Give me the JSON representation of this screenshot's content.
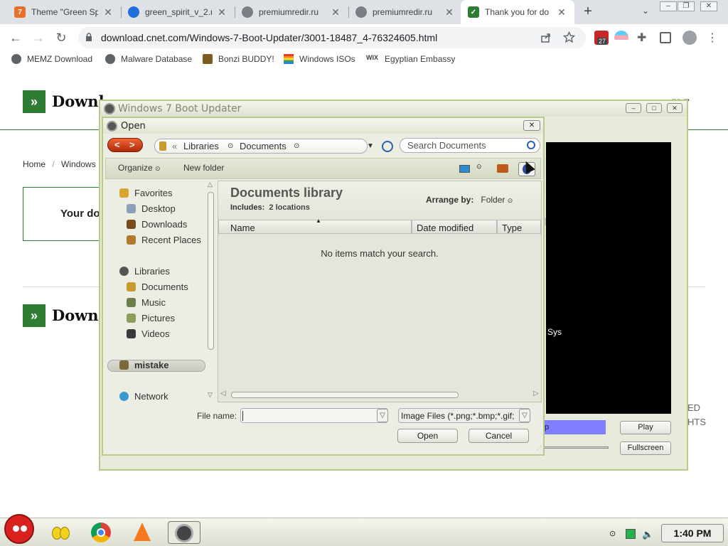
{
  "browser": {
    "tabs": [
      {
        "title": "Theme \"Green Sp",
        "favicon": "seven-favicon",
        "active": false
      },
      {
        "title": "green_spirit_v_2.r",
        "favicon": "edge-favicon",
        "active": false
      },
      {
        "title": "premiumredir.ru",
        "favicon": "globe-favicon",
        "active": false
      },
      {
        "title": "premiumredir.ru",
        "favicon": "globe-favicon",
        "active": false
      },
      {
        "title": "Thank you for do",
        "favicon": "cnet-favicon",
        "active": true
      }
    ],
    "new_tab_label": "+",
    "url": "download.cnet.com/Windows-7-Boot-Updater/3001-18487_4-76324605.html",
    "extension_badge": "27",
    "bookmarks": [
      "MEMZ Download",
      "Malware Database",
      "Bonzi BUDDY!",
      "Windows ISOs",
      "Egyptian Embassy"
    ]
  },
  "page": {
    "logo_text": "Downl",
    "logo_text_2": "Downl",
    "more_label": "re",
    "breadcrumb": [
      "Home",
      "Windows"
    ],
    "breadcrumb_sep": "/",
    "your_download_text": "Your do",
    "right_snippets": [
      "ED",
      "HTS"
    ]
  },
  "boot_updater": {
    "title": "Windows 7 Boot Updater",
    "ghost_text": "tion",
    "preview_label": "d Sys",
    "purple_label": "p",
    "play_label": "Play",
    "fullscreen_label": "Fullscreen"
  },
  "open_dialog": {
    "title": "Open",
    "close_label": "✕",
    "breadcrumb_prefix": "«",
    "breadcrumb": [
      "Libraries",
      "Documents"
    ],
    "search_placeholder": "Search Documents",
    "organize_label": "Organize",
    "new_folder_label": "New folder",
    "nav": {
      "favorites_label": "Favorites",
      "favorites": [
        "Desktop",
        "Downloads",
        "Recent Places"
      ],
      "libraries_label": "Libraries",
      "libraries": [
        "Documents",
        "Music",
        "Pictures",
        "Videos"
      ],
      "homegroup_label": "mistake",
      "network_label": "Network"
    },
    "library": {
      "title": "Documents library",
      "includes_label": "Includes:",
      "includes_value": "2 locations",
      "arrange_label": "Arrange by:",
      "arrange_value": "Folder"
    },
    "columns": [
      "Name",
      "Date modified",
      "Type"
    ],
    "empty_message": "No items match your search.",
    "file_name_label": "File name:",
    "file_name_value": "",
    "filter_value": "Image Files (*.png;*.bmp;*.gif;",
    "open_label": "Open",
    "cancel_label": "Cancel"
  },
  "taskbar": {
    "clock": "1:40 PM"
  },
  "colors": {
    "cnet_green": "#2e7d32",
    "theme_border": "#b7cc8a",
    "preview_bg": "#000000",
    "purple_bar": "#8080ff"
  }
}
